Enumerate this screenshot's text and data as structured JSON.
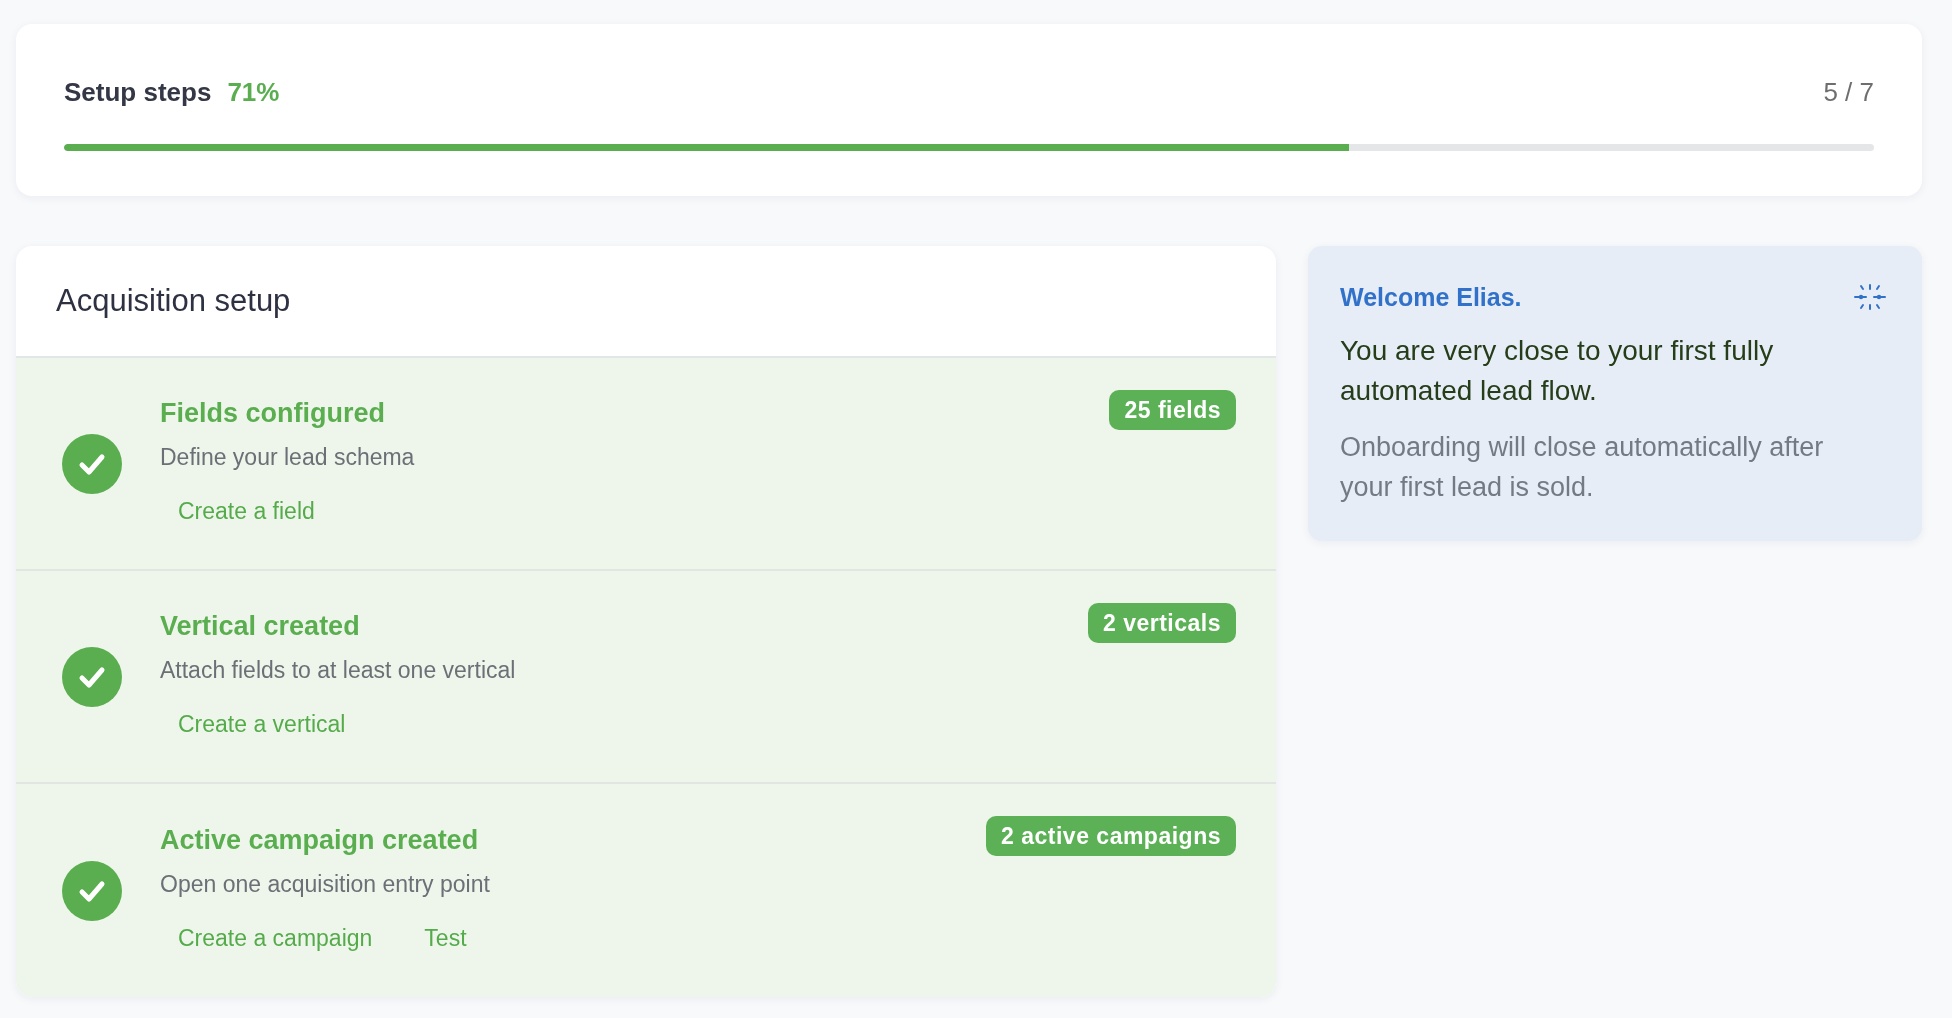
{
  "progress": {
    "title": "Setup steps",
    "percent": "71%",
    "count": "5 / 7",
    "level": 0.71
  },
  "setup": {
    "title": "Acquisition setup",
    "steps": [
      {
        "title": "Fields configured",
        "description": "Define your lead schema",
        "badge": "25 fields",
        "done": true,
        "links": [
          "Create a field"
        ]
      },
      {
        "title": "Vertical created",
        "description": "Attach fields to at least one vertical",
        "badge": "2 verticals",
        "done": true,
        "links": [
          "Create a vertical"
        ]
      },
      {
        "title": "Active campaign created",
        "description": "Open one acquisition entry point",
        "badge": "2 active campaigns",
        "done": true,
        "links": [
          "Create a campaign",
          "Test"
        ]
      }
    ]
  },
  "welcome": {
    "title": "Welcome Elias.",
    "message": "You are very close to your first fully automated lead flow.",
    "note": "Onboarding will close automatically after your first lead is sold."
  }
}
